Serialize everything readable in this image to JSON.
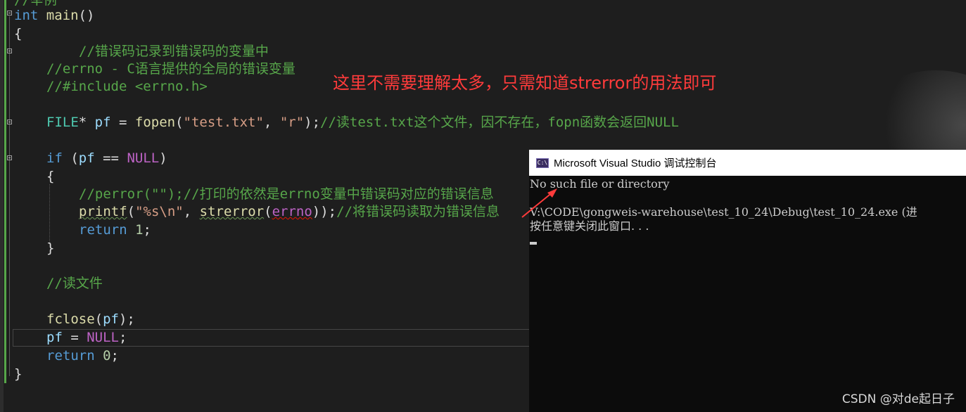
{
  "editor": {
    "lines": {
      "l0": "//举例",
      "l1_kw": "int",
      "l1_fn": "main",
      "l1_rest": "()",
      "l2": "{",
      "l3": "//错误码记录到错误码的变量中",
      "l4": "//errno - C语言提供的全局的错误变量",
      "l5": "//#include <errno.h>",
      "l7_type": "FILE",
      "l7_star": "* ",
      "l7_var": "pf",
      "l7_eq": " = ",
      "l7_fn": "fopen",
      "l7_open": "(",
      "l7_s1": "\"test.txt\"",
      "l7_comma": ", ",
      "l7_s2": "\"r\"",
      "l7_close": ");",
      "l7_cmt": "//读test.txt这个文件，因不存在，fopn函数会返回NULL",
      "l9_kw": "if",
      "l9_a": " (",
      "l9_var": "pf",
      "l9_b": " == ",
      "l9_mac": "NULL",
      "l9_c": ")",
      "l10": "{",
      "l11": "//perror(\"\");//打印的依然是errno变量中错误码对应的错误信息",
      "l12_fn": "printf",
      "l12_a": "(",
      "l12_str": "\"%s\\n\"",
      "l12_b": ", ",
      "l12_fn2": "strerror",
      "l12_c": "(",
      "l12_mac": "errno",
      "l12_d": "));",
      "l12_cmt": "//将错误码读取为错误信息",
      "l13_kw": "return",
      "l13_num": "1",
      "l13_end": ";",
      "l14": "}",
      "l16": "//读文件",
      "l18_fn": "fclose",
      "l18_a": "(",
      "l18_var": "pf",
      "l18_b": ");",
      "l19_var": "pf",
      "l19_a": " = ",
      "l19_mac": "NULL",
      "l19_b": ";",
      "l20_kw": "return",
      "l20_num": "0",
      "l20_end": ";",
      "l21": "}"
    }
  },
  "annotation": "这里不需要理解太多，只需知道strerror的用法即可",
  "console": {
    "icon_text": "C:\\",
    "title": "Microsoft Visual Studio 调试控制台",
    "output_line1": "No such file or directory",
    "output_line2": "V:\\CODE\\gongweis-warehouse\\test_10_24\\Debug\\test_10_24.exe (进",
    "output_line3": "按任意键关闭此窗口. . ."
  },
  "watermark": "CSDN @对de起日子",
  "colors": {
    "background": "#1e1e1e",
    "keyword": "#569cd6",
    "function": "#dcdcaa",
    "comment": "#57a64a",
    "annotation": "#ff3b3b"
  }
}
